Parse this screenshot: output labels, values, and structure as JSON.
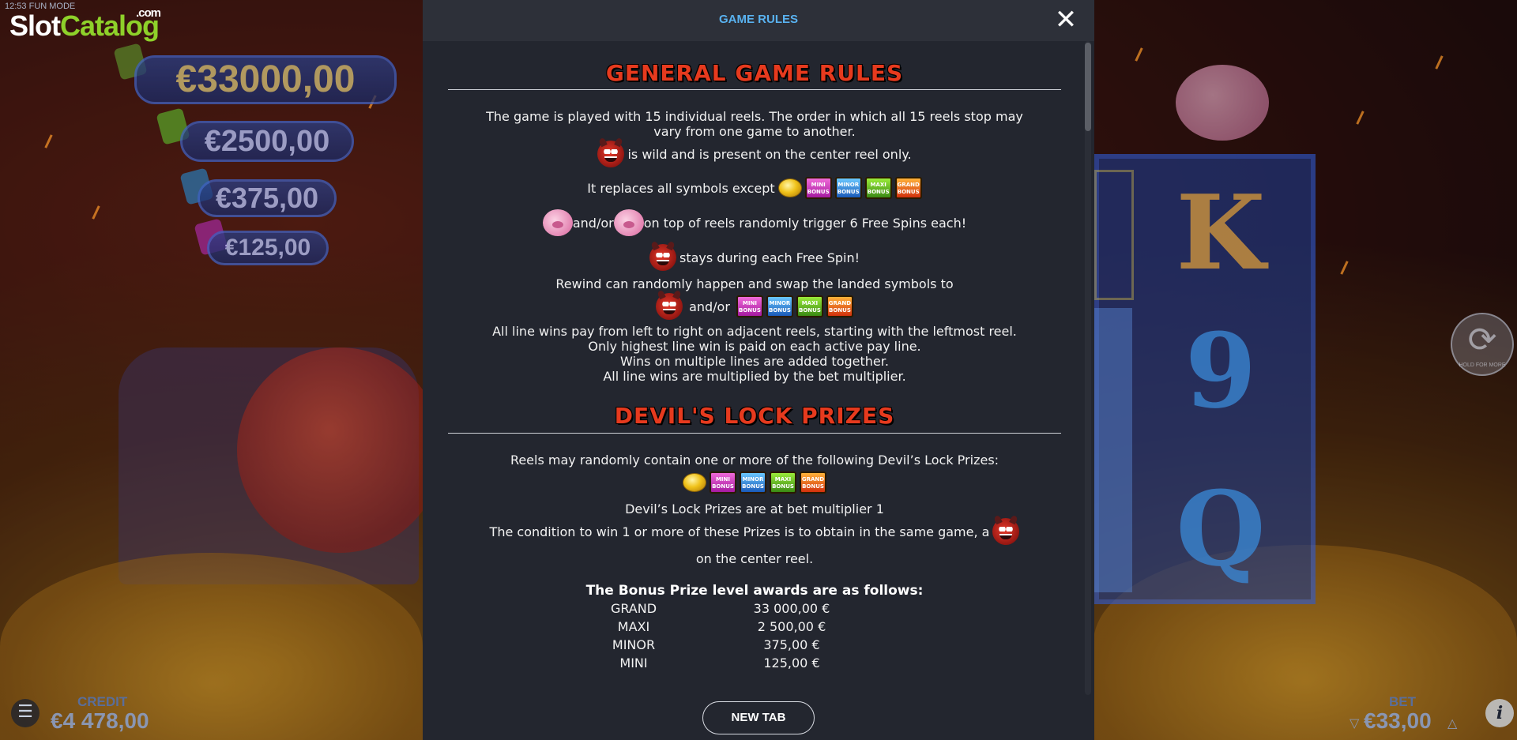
{
  "status": {
    "time": "12:53",
    "mode": "FUN MODE"
  },
  "logo": {
    "part1": "Slot",
    "part2": "Catalog",
    "suffix": ".com"
  },
  "jackpots": {
    "grand": "€33000,00",
    "maxi": "€2500,00",
    "minor": "€375,00",
    "mini": "€125,00"
  },
  "reels_visible": {
    "k": "K",
    "nine": "9",
    "q": "Q"
  },
  "spin_button": {
    "hint": "HOLD FOR MORE"
  },
  "bottom": {
    "credit_label": "CREDIT",
    "credit_value": "€4 478,00",
    "bet_label": "BET",
    "bet_value": "€33,00"
  },
  "modal": {
    "title": "GAME RULES",
    "close_symbol": "✕",
    "new_tab_label": "NEW TAB",
    "general": {
      "heading": "GENERAL GAME RULES",
      "intro_1": "The game is played with 15 individual reels. The order in which all 15 reels stop may",
      "intro_2": "vary from one game to another.",
      "wild_text": "is wild and is present on the center reel only.",
      "replaces_text": "It replaces all symbols except",
      "and_or": "and/or",
      "free_spins_text": "on top of reels randomly trigger 6 Free Spins each!",
      "stays_text": "stays during each Free Spin!",
      "rewind_text": "Rewind can randomly happen and swap the landed symbols to",
      "and_or_2": "and/or",
      "line_1": "All line wins pay from left to right on adjacent reels, starting with the leftmost reel.",
      "line_2": "Only highest line win is paid on each active pay line.",
      "line_3": "Wins on multiple lines are added together.",
      "line_4": "All line wins are multiplied by the bet multiplier."
    },
    "devils_lock": {
      "heading": "DEVIL'S LOCK PRIZES",
      "reels_text": "Reels may randomly contain one or more of the following Devil’s Lock Prizes:",
      "multiplier_text": "Devil’s Lock Prizes are at bet multiplier 1",
      "condition_text": "The condition to win 1 or more of these Prizes is to obtain in the same game, a",
      "center_text": "on the center reel.",
      "awards_heading": "The Bonus Prize level awards are as follows:",
      "awards": [
        {
          "name": "GRAND",
          "amount": "33 000,00 €"
        },
        {
          "name": "MAXI",
          "amount": "2 500,00 €"
        },
        {
          "name": "MINOR",
          "amount": "375,00 €"
        },
        {
          "name": "MINI",
          "amount": "125,00 €"
        }
      ]
    },
    "badges": {
      "mini": "MINI BONUS",
      "minor": "MINOR BONUS",
      "maxi": "MAXI BONUS",
      "grand": "GRAND BONUS"
    }
  }
}
